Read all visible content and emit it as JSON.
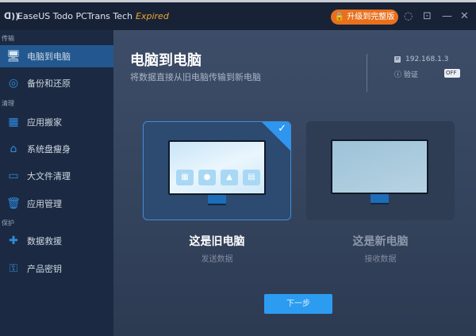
{
  "titlebar": {
    "logo": "ᗡ))",
    "app_name": "EaseUS Todo PCTrans Tech",
    "status": "Expired",
    "upgrade_label": "🔒 升级到完整版",
    "icons": [
      "support-icon",
      "menu-icon",
      "minimize-icon",
      "close-icon"
    ]
  },
  "sidebar": {
    "sections": [
      "传输",
      "清理",
      "保护"
    ],
    "items": [
      {
        "label": "电脑到电脑",
        "icon": "🖥"
      },
      {
        "label": "备份和还原",
        "icon": "◎"
      },
      {
        "label": "应用搬家",
        "icon": "▦"
      },
      {
        "label": "系统盘瘦身",
        "icon": "⌂"
      },
      {
        "label": "大文件清理",
        "icon": "▭"
      },
      {
        "label": "应用管理",
        "icon": "🗑"
      },
      {
        "label": "数据救援",
        "icon": "✚"
      },
      {
        "label": "产品密钥",
        "icon": "⚿"
      }
    ]
  },
  "main": {
    "title": "电脑到电脑",
    "subtitle": "将数据直接从旧电脑传输到新电脑",
    "ip_badge": "IP",
    "ip": "192.168.1.3",
    "verify_label": "验证",
    "verify_toggle": "OFF",
    "old_pc": {
      "title": "这是旧电脑",
      "subtitle": "发送数据",
      "selected": true
    },
    "new_pc": {
      "title": "这是新电脑",
      "subtitle": "接收数据",
      "selected": false
    },
    "next_label": "下一步"
  },
  "colors": {
    "accent": "#2c9cf0",
    "upgrade": "#e8701d",
    "expired": "#f0a830"
  }
}
